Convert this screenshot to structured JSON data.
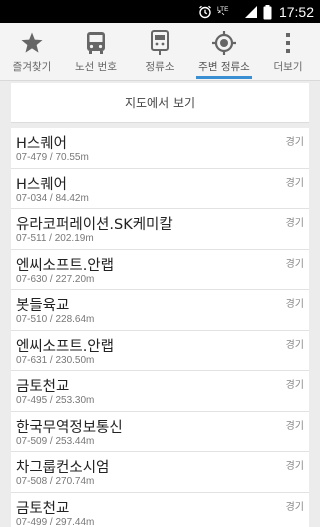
{
  "status_bar": {
    "time": "17:52",
    "icons": [
      "alarm-icon",
      "signal-icon",
      "lte-icon",
      "battery-icon"
    ],
    "network_label": "LTE"
  },
  "tabs": [
    {
      "label": "즐겨찾기",
      "icon": "star-icon"
    },
    {
      "label": "노선 번호",
      "icon": "bus-icon"
    },
    {
      "label": "정류소",
      "icon": "bus-stop-icon"
    },
    {
      "label": "주변 정류소",
      "icon": "location-target-icon",
      "active": true
    },
    {
      "label": "더보기",
      "icon": "more-vertical-icon"
    }
  ],
  "map_view_label": "지도에서 보기",
  "stops": [
    {
      "name": "H스퀘어",
      "sub": "07-479 / 70.55m",
      "region": "경기"
    },
    {
      "name": "H스퀘어",
      "sub": "07-034 / 84.42m",
      "region": "경기"
    },
    {
      "name": "유라코퍼레이션.SK케미칼",
      "sub": "07-511 / 202.19m",
      "region": "경기"
    },
    {
      "name": "엔씨소프트.안랩",
      "sub": "07-630 / 227.20m",
      "region": "경기"
    },
    {
      "name": "봇들육교",
      "sub": "07-510 / 228.64m",
      "region": "경기"
    },
    {
      "name": "엔씨소프트.안랩",
      "sub": "07-631 / 230.50m",
      "region": "경기"
    },
    {
      "name": "금토천교",
      "sub": "07-495 / 253.30m",
      "region": "경기"
    },
    {
      "name": "한국무역정보통신",
      "sub": "07-509 / 253.44m",
      "region": "경기"
    },
    {
      "name": "차그룹컨소시엄",
      "sub": "07-508 / 270.74m",
      "region": "경기"
    },
    {
      "name": "금토천교",
      "sub": "07-499 / 297.44m",
      "region": "경기"
    }
  ],
  "colors": {
    "accent": "#3a8fd2",
    "icon_gray": "#666666",
    "background": "#ececec"
  }
}
